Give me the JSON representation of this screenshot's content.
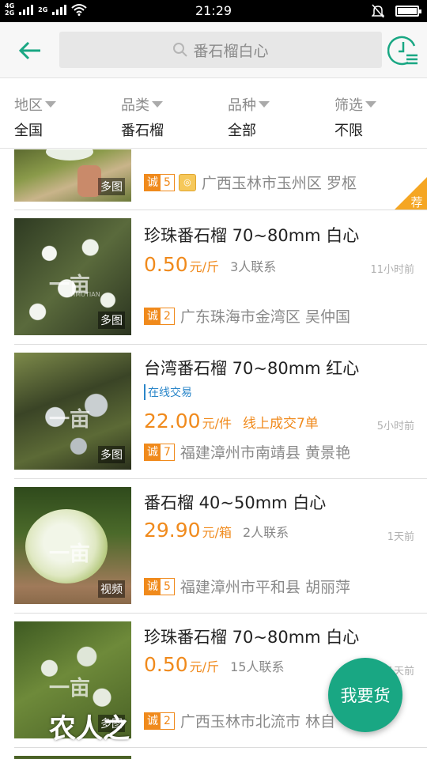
{
  "status_bar": {
    "time": "21:29",
    "net_top": "4G",
    "net_bottom": "2G",
    "net_top2": "2G"
  },
  "header": {
    "search_text": "番石榴白心"
  },
  "filters": [
    {
      "label": "地区",
      "value": "全国"
    },
    {
      "label": "品类",
      "value": "番石榴"
    },
    {
      "label": "品种",
      "value": "全部"
    },
    {
      "label": "筛选",
      "value": "不限"
    }
  ],
  "items": [
    {
      "credit": "5",
      "location": "广西玉林市玉州区 罗枢",
      "media_badge": "多图",
      "recommend": "荐"
    },
    {
      "title": "珍珠番石榴 70~80mm 白心",
      "price": "0.50",
      "unit": "元/斤",
      "contacts": "3人联系",
      "time": "11小时前",
      "credit": "2",
      "location": "广东珠海市金湾区 吴仲国",
      "media_badge": "多图"
    },
    {
      "title": "台湾番石榴 70~80mm 红心",
      "online_tag": "在线交易",
      "price": "22.00",
      "unit": "元/件",
      "deals": "线上成交7单",
      "time": "5小时前",
      "credit": "7",
      "location": "福建漳州市南靖县 黄景艳",
      "media_badge": "多图"
    },
    {
      "title": "番石榴 40~50mm 白心",
      "price": "29.90",
      "unit": "元/箱",
      "contacts": "2人联系",
      "time": "1天前",
      "credit": "5",
      "location": "福建漳州市平和县 胡丽萍",
      "media_badge": "视频"
    },
    {
      "title": "珍珠番石榴 70~80mm 白心",
      "price": "0.50",
      "unit": "元/斤",
      "contacts": "15人联系",
      "time": "1天前",
      "credit": "2",
      "location": "广西玉林市北流市 林自",
      "media_badge": "多图"
    }
  ],
  "credit_label": "诚",
  "watermark": "一亩",
  "watermark_small": "YIMUTIAN",
  "fab_label": "我要货",
  "brand_mark": "农人之",
  "colors": {
    "accent": "#19a783",
    "price": "#f08a1c",
    "link": "#2a86c9"
  }
}
